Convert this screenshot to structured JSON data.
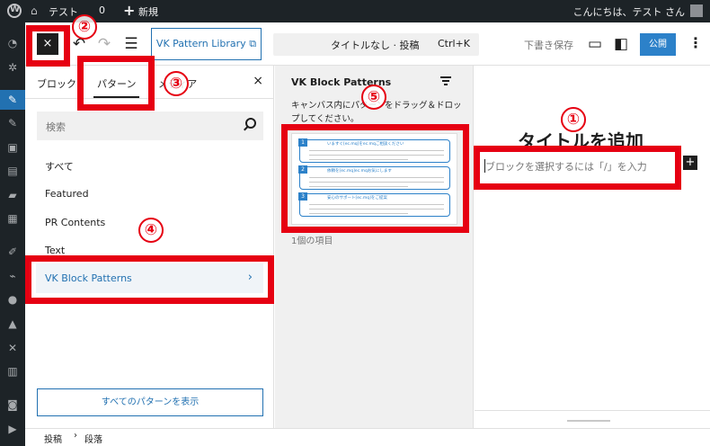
{
  "admin_bar": {
    "site_name": "テスト",
    "site_suffix": "0",
    "new_label": "新規",
    "howdy": "こんにちは、テスト さん"
  },
  "toolbar": {
    "close_label": "×",
    "vk_pattern_library": "VK Pattern Library",
    "command_title": "タイトルなし · 投稿",
    "command_shortcut": "Ctrl+K",
    "draft_save": "下書き保存",
    "publish": "公開",
    "more": "⋮"
  },
  "inserter": {
    "tabs": [
      {
        "label": "ブロック"
      },
      {
        "label": "パターン"
      },
      {
        "label": "メディア"
      }
    ],
    "close": "×",
    "search_placeholder": "検索",
    "categories": [
      "すべて",
      "Featured",
      "PR Contents",
      "Text"
    ],
    "selected_category": "VK Block Patterns",
    "show_all": "すべてのパターンを表示"
  },
  "pattern_panel": {
    "title": "VK Block Patterns",
    "description": "キャンバス内にパターンをドラッグ＆ドロップしてください。",
    "count": "1個の項目",
    "thumbnail_rows": [
      {
        "num": "1",
        "heading": "いますぐ[ec.mq]をec.mqご相談ください"
      },
      {
        "num": "2",
        "heading": "依頼を[ec.mq]ec.mqお気にします"
      },
      {
        "num": "3",
        "heading": "安心のサポート[ec.mq]をご提案"
      }
    ]
  },
  "canvas": {
    "title_placeholder": "タイトルを追加",
    "paragraph_placeholder": "ブロックを選択するには「/」を入力",
    "add_block": "+"
  },
  "footer": {
    "crumb1": "投稿",
    "sep": "›",
    "crumb2": "段落"
  },
  "annotations": [
    "②",
    "③",
    "⑤",
    "①",
    "④"
  ],
  "colors": {
    "highlight": "#e60012",
    "accent": "#2271b1",
    "admin_bg": "#1d2327"
  }
}
